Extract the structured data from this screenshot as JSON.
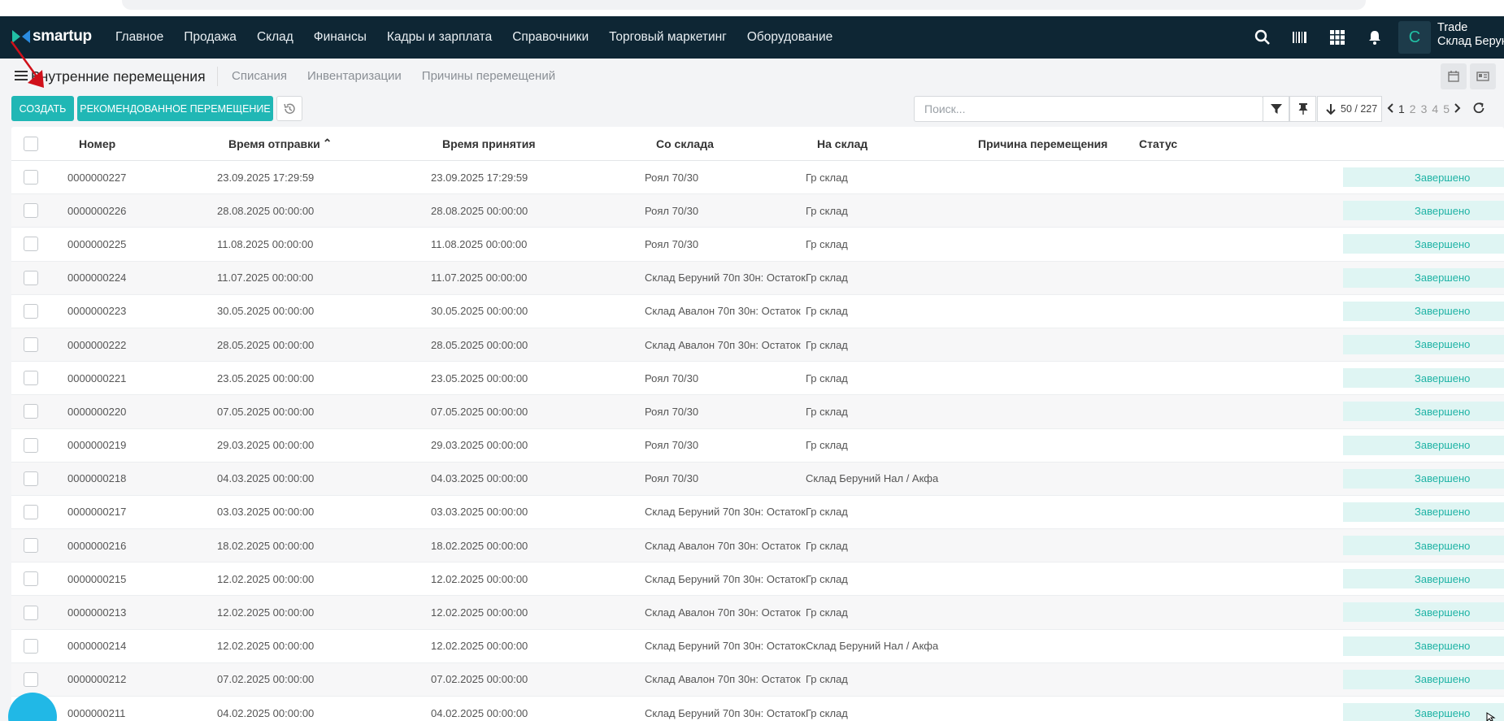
{
  "app": {
    "logo": "smartup",
    "nav": [
      "Главное",
      "Продажа",
      "Склад",
      "Финансы",
      "Кадры и зарплата",
      "Справочники",
      "Торговый маркетинг",
      "Оборудование"
    ],
    "avatar_letter": "C",
    "user_name": "Trade",
    "user_warehouse": "Склад Берун"
  },
  "page": {
    "title": "Внутренние перемещения",
    "tabs": [
      "Списания",
      "Инвентаризации",
      "Причины перемещений"
    ]
  },
  "toolbar": {
    "create_label": "СОЗДАТЬ",
    "recommended_label": "РЕКОМЕНДОВАННОЕ ПЕРЕМЕЩЕНИЕ",
    "search_placeholder": "Поиск...",
    "count": "50 / 227",
    "pages": [
      "1",
      "2",
      "3",
      "4",
      "5"
    ]
  },
  "table": {
    "columns": [
      "Номер",
      "Время отправки",
      "Время принятия",
      "Со склада",
      "На склад",
      "Причина перемещения",
      "Статус"
    ],
    "sort_indicator": "⌃",
    "rows": [
      {
        "number": "0000000227",
        "sent": "23.09.2025 17:29:59",
        "received": "23.09.2025 17:29:59",
        "from": "Роял 70/30",
        "to": "Гр склад",
        "reason": "",
        "status": "Завершено"
      },
      {
        "number": "0000000226",
        "sent": "28.08.2025 00:00:00",
        "received": "28.08.2025 00:00:00",
        "from": "Роял 70/30",
        "to": "Гр склад",
        "reason": "",
        "status": "Завершено"
      },
      {
        "number": "0000000225",
        "sent": "11.08.2025 00:00:00",
        "received": "11.08.2025 00:00:00",
        "from": "Роял 70/30",
        "to": "Гр склад",
        "reason": "",
        "status": "Завершено"
      },
      {
        "number": "0000000224",
        "sent": "11.07.2025 00:00:00",
        "received": "11.07.2025 00:00:00",
        "from": "Склад Беруний 70п 30н: Остаток",
        "to": "Гр склад",
        "reason": "",
        "status": "Завершено"
      },
      {
        "number": "0000000223",
        "sent": "30.05.2025 00:00:00",
        "received": "30.05.2025 00:00:00",
        "from": "Склад Авалон 70п 30н: Остаток",
        "to": "Гр склад",
        "reason": "",
        "status": "Завершено"
      },
      {
        "number": "0000000222",
        "sent": "28.05.2025 00:00:00",
        "received": "28.05.2025 00:00:00",
        "from": "Склад Авалон 70п 30н: Остаток",
        "to": "Гр склад",
        "reason": "",
        "status": "Завершено"
      },
      {
        "number": "0000000221",
        "sent": "23.05.2025 00:00:00",
        "received": "23.05.2025 00:00:00",
        "from": "Роял 70/30",
        "to": "Гр склад",
        "reason": "",
        "status": "Завершено"
      },
      {
        "number": "0000000220",
        "sent": "07.05.2025 00:00:00",
        "received": "07.05.2025 00:00:00",
        "from": "Роял 70/30",
        "to": "Гр склад",
        "reason": "",
        "status": "Завершено"
      },
      {
        "number": "0000000219",
        "sent": "29.03.2025 00:00:00",
        "received": "29.03.2025 00:00:00",
        "from": "Роял 70/30",
        "to": "Гр склад",
        "reason": "",
        "status": "Завершено"
      },
      {
        "number": "0000000218",
        "sent": "04.03.2025 00:00:00",
        "received": "04.03.2025 00:00:00",
        "from": "Роял 70/30",
        "to": "Склад Беруний Нал / Акфа",
        "reason": "",
        "status": "Завершено"
      },
      {
        "number": "0000000217",
        "sent": "03.03.2025 00:00:00",
        "received": "03.03.2025 00:00:00",
        "from": "Склад Беруний 70п 30н: Остаток",
        "to": "Гр склад",
        "reason": "",
        "status": "Завершено"
      },
      {
        "number": "0000000216",
        "sent": "18.02.2025 00:00:00",
        "received": "18.02.2025 00:00:00",
        "from": "Склад Авалон 70п 30н: Остаток",
        "to": "Гр склад",
        "reason": "",
        "status": "Завершено"
      },
      {
        "number": "0000000215",
        "sent": "12.02.2025 00:00:00",
        "received": "12.02.2025 00:00:00",
        "from": "Склад Беруний 70п 30н: Остаток",
        "to": "Гр склад",
        "reason": "",
        "status": "Завершено"
      },
      {
        "number": "0000000213",
        "sent": "12.02.2025 00:00:00",
        "received": "12.02.2025 00:00:00",
        "from": "Склад Авалон 70п 30н: Остаток",
        "to": "Гр склад",
        "reason": "",
        "status": "Завершено"
      },
      {
        "number": "0000000214",
        "sent": "12.02.2025 00:00:00",
        "received": "12.02.2025 00:00:00",
        "from": "Склад Беруний 70п 30н: Остаток",
        "to": "Склад Беруний Нал / Акфа",
        "reason": "",
        "status": "Завершено"
      },
      {
        "number": "0000000212",
        "sent": "07.02.2025 00:00:00",
        "received": "07.02.2025 00:00:00",
        "from": "Склад Авалон 70п 30н: Остаток",
        "to": "Гр склад",
        "reason": "",
        "status": "Завершено"
      },
      {
        "number": "0000000211",
        "sent": "04.02.2025 00:00:00",
        "received": "04.02.2025 00:00:00",
        "from": "Склад Беруний 70п 30н: Остаток",
        "to": "Гр склад",
        "reason": "",
        "status": "Завершено"
      }
    ]
  },
  "colors": {
    "topbar": "#0e2634",
    "accent": "#20b7b5",
    "status_bg": "#dff5f3",
    "status_text": "#1fb3a5",
    "annotation_arrow": "#d0101a"
  },
  "icons": [
    "logo-icon",
    "search-icon",
    "barcode-icon",
    "apps-grid-icon",
    "bell-icon",
    "menu-icon",
    "history-icon",
    "filter-icon",
    "pin-icon",
    "sort-down-icon",
    "chevron-left-icon",
    "chevron-right-icon",
    "refresh-icon",
    "calendar-view-icon",
    "card-view-icon",
    "annotation-arrow-icon",
    "mouse-cursor-icon"
  ]
}
